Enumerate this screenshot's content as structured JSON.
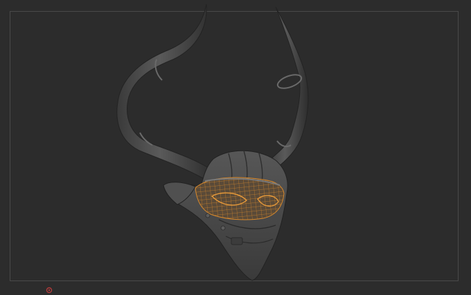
{
  "viewport": {
    "background_color": "#2c2c2c",
    "frame_color": "#4a4a4a",
    "model": {
      "material_color": "#4a4a4a",
      "wireframe_color": "#d8892c",
      "wireframe_visible": true
    },
    "gizmo": {
      "icon": "axis-gizmo-icon",
      "color": "#b03a3a"
    }
  }
}
